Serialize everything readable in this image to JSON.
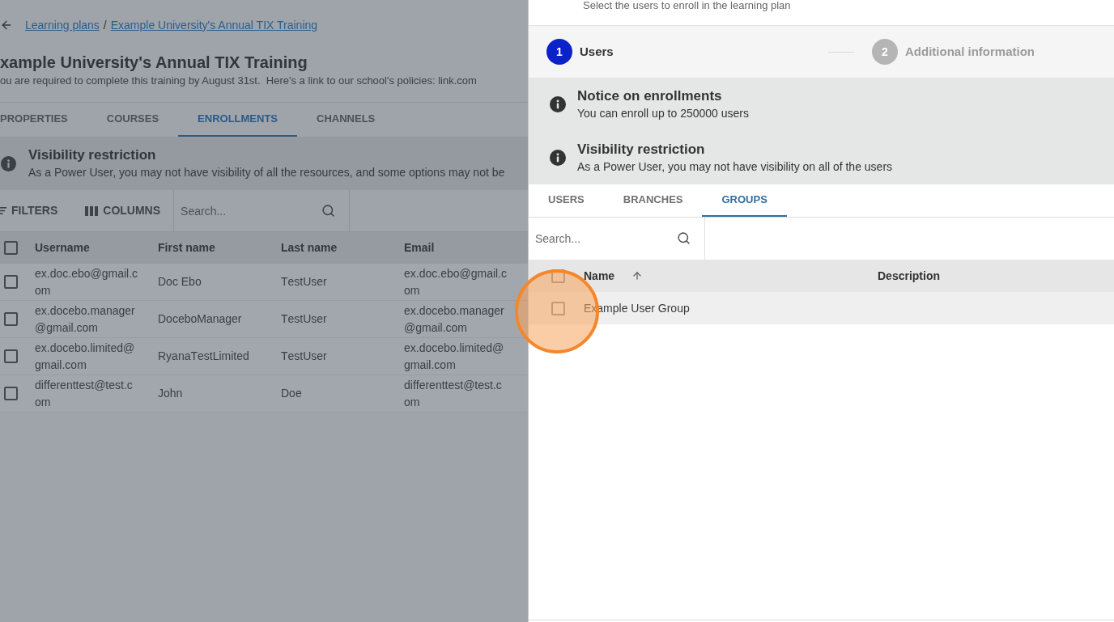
{
  "page": {
    "breadcrumbs": [
      "Learning plans",
      "Example University's Annual TIX Training"
    ],
    "breadcrumb_separator": "/",
    "title": "xample University's Annual TIX Training",
    "description": "ou are required to complete this training by August 31st.  Here's a link to our school's policies: link.com",
    "tabs": [
      {
        "label": "PROPERTIES",
        "selected": false
      },
      {
        "label": "COURSES",
        "selected": false
      },
      {
        "label": "ENROLLMENTS",
        "selected": true
      },
      {
        "label": "CHANNELS",
        "selected": false
      }
    ],
    "notice": {
      "title": "Visibility restriction",
      "text": "As a Power User, you may not have visibility of all the resources, and some options may not be"
    },
    "toolbar": {
      "filters": "FILTERS",
      "columns": "COLUMNS",
      "search": {
        "placeholder": "Search..."
      }
    },
    "table": {
      "header_checked": false,
      "columns": [
        "Username",
        "First name",
        "Last name",
        "Email"
      ],
      "rows": [
        {
          "checked": false,
          "cells": [
            "ex.doc.ebo@gmail.com",
            "Doc Ebo",
            "TestUser",
            "ex.doc.ebo@gmail.com"
          ]
        },
        {
          "checked": false,
          "cells": [
            "ex.docebo.manager@gmail.com",
            "DoceboManager",
            "TestUser",
            "ex.docebo.manager@gmail.com"
          ]
        },
        {
          "checked": false,
          "cells": [
            "ex.docebo.limited@gmail.com",
            "RyanaTestLimited",
            "TestUser",
            "ex.docebo.limited@gmail.com"
          ]
        },
        {
          "checked": false,
          "cells": [
            "differenttest@test.com",
            "John",
            "Doe",
            "differenttest@test.com"
          ]
        }
      ]
    }
  },
  "drawer": {
    "subtitle": "Select the users to enroll in the learning plan",
    "steps": [
      {
        "number": "1",
        "label": "Users",
        "selected": true
      },
      {
        "number": "2",
        "label": "Additional information",
        "selected": false
      }
    ],
    "notices": [
      {
        "title": "Notice on enrollments",
        "text": "You can enroll up to 250000 users"
      },
      {
        "title": "Visibility restriction",
        "text": "As a Power User, you may not have visibility on all of the users"
      }
    ],
    "tabs": [
      {
        "label": "USERS",
        "selected": false
      },
      {
        "label": "BRANCHES",
        "selected": false
      },
      {
        "label": "GROUPS",
        "selected": true
      }
    ],
    "search": {
      "placeholder": "Search..."
    },
    "table": {
      "header_checked": false,
      "columns": [
        {
          "label": "Name",
          "sorted": true
        },
        {
          "label": "Description",
          "sorted": false
        }
      ],
      "rows": [
        {
          "checked": false,
          "highlighted": true,
          "name": "Example User Group"
        }
      ]
    }
  }
}
